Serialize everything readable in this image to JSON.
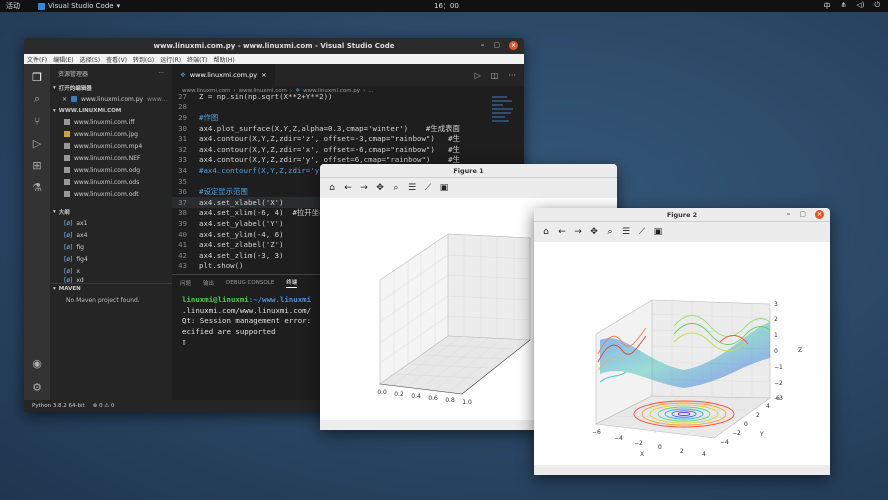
{
  "topbar": {
    "activities": "活动",
    "app_name": "Visual Studio Code",
    "clock": "16：00",
    "input_method": "中"
  },
  "vscode": {
    "title": "www.linuxmi.com.py - www.linuxmi.com - Visual Studio Code",
    "menu": [
      "文件(F)",
      "编辑(E)",
      "选择(S)",
      "查看(V)",
      "转到(G)",
      "运行(R)",
      "终端(T)",
      "帮助(H)"
    ],
    "explorer_title": "资源管理器",
    "open_editors_label": "打开的编辑器",
    "open_editor_file": "www.linuxmi.com.py",
    "open_editor_folder": "www...",
    "folder_label": "WWW.LINUXMI.COM",
    "files": [
      "www.linuxmi.com.iff",
      "www.linuxmi.com.jpg",
      "www.linuxmi.com.mp4",
      "www.linuxmi.com.NEF",
      "www.linuxmi.com.odg",
      "www.linuxmi.com.ods",
      "www.linuxmi.com.odt"
    ],
    "outline_label": "大纲",
    "outline_items": [
      "ax1",
      "ax4",
      "fig",
      "fig4",
      "x",
      "xd"
    ],
    "maven_label": "MAVEN",
    "maven_msg": "No Maven project found.",
    "tab_label": "www.linuxmi.com.py",
    "breadcrumb": [
      "www.linuxmi.com",
      "www.linuxmi.com",
      "www.linuxmi.com.py",
      "..."
    ],
    "code_lines": [
      {
        "n": "27",
        "t": "Z = np.sin(np.sqrt(X**2+Y**2))"
      },
      {
        "n": "28",
        "t": ""
      },
      {
        "n": "29",
        "t": "#作图"
      },
      {
        "n": "30",
        "t": "ax4.plot_surface(X,Y,Z,alpha=0.3,cmap='winter')    #生成表面"
      },
      {
        "n": "31",
        "t": "ax4.contour(X,Y,Z,zdir='z', offset=-3,cmap=\"rainbow\")   #生"
      },
      {
        "n": "32",
        "t": "ax4.contour(X,Y,Z,zdir='x', offset=-6,cmap=\"rainbow\")   #生"
      },
      {
        "n": "33",
        "t": "ax4.contour(X,Y,Z,zdir='y', offset=6,cmap=\"rainbow\")    #生"
      },
      {
        "n": "34",
        "t": "#ax4.contourf(X,Y,Z,zdir='y', offset=6,cmap=\"rainbow\")"
      },
      {
        "n": "35",
        "t": ""
      },
      {
        "n": "36",
        "t": "#设定显示范围"
      },
      {
        "n": "37",
        "t": "ax4.set_xlabel('X')"
      },
      {
        "n": "38",
        "t": "ax4.set_xlim(-6, 4)  #拉开坐标"
      },
      {
        "n": "39",
        "t": "ax4.set_ylabel('Y')"
      },
      {
        "n": "40",
        "t": "ax4.set_ylim(-4, 6)"
      },
      {
        "n": "41",
        "t": "ax4.set_zlabel('Z')"
      },
      {
        "n": "42",
        "t": "ax4.set_zlim(-3, 3)"
      },
      {
        "n": "43",
        "t": "plt.show()"
      }
    ],
    "panel_tabs": [
      "问题",
      "输出",
      "DEBUG CONSOLE",
      "终端"
    ],
    "terminal": {
      "prompt_user": "linuxmi@linuxmi",
      "prompt_path": ":~/www.linuxmi",
      "line2": ".linuxmi.com/www.linuxmi.com/",
      "line3": "Qt: Session management error:",
      "line4": "ecified are supported",
      "cursor": "▯"
    },
    "status_python": "Python 3.8.2 64-bit",
    "status_problems": "⊗ 0 ⚠ 0"
  },
  "figure1": {
    "title": "Figure 1",
    "x_ticks": [
      "0.0",
      "0.2",
      "0.4",
      "0.6",
      "0.8",
      "1.0"
    ]
  },
  "figure2": {
    "title": "Figure 2",
    "x_ticks": [
      "−6",
      "−4",
      "−2",
      "0",
      "2",
      "4"
    ],
    "y_ticks": [
      "−4",
      "−2",
      "0",
      "2",
      "4",
      "6"
    ],
    "z_ticks": [
      "3",
      "2",
      "1",
      "0",
      "−1",
      "−2",
      "−3"
    ],
    "xlabel": "X",
    "ylabel": "Y",
    "zlabel": "Z"
  },
  "colors": {
    "accent": "#e95420",
    "editor_bg": "#1e1e1e",
    "sidebar_bg": "#252526"
  }
}
